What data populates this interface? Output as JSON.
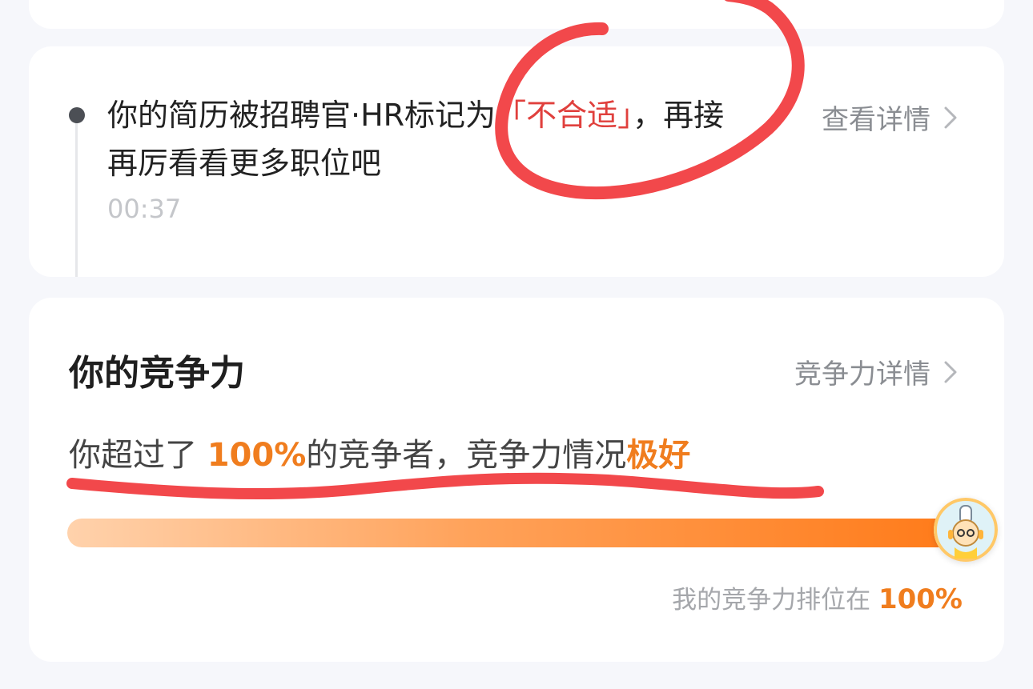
{
  "notice": {
    "text_before": "你的简历被招聘官·HR标记为",
    "text_highlight": "「不合适」",
    "text_after": "，再接再厉看看更多职位吧",
    "time": "00:37",
    "link_label": "查看详情"
  },
  "competitiveness": {
    "title": "你的竞争力",
    "link_label": "竞争力详情",
    "summary_prefix": "你超过了",
    "summary_percent": "100%",
    "summary_middle": "的竞争者，竞争力情况",
    "summary_level": "极好",
    "progress_fraction": 1.0,
    "rank_prefix": "我的竞争力排位在",
    "rank_percent": "100%"
  },
  "colors": {
    "accent_orange": "#f07d1e",
    "alert_red": "#e0403d",
    "annotation_red": "#f2484b"
  },
  "icons": {
    "chevron": "chevron-right-icon",
    "avatar": "mascot-avatar-icon"
  }
}
